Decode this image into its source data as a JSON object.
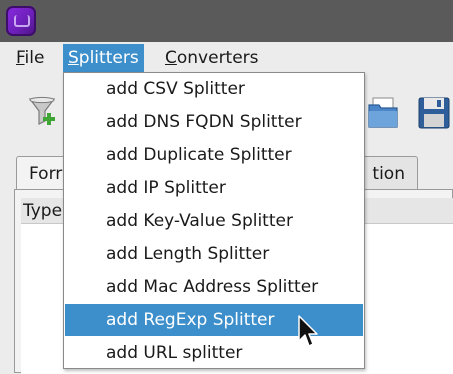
{
  "menubar": {
    "items": [
      {
        "first": "F",
        "rest": "ile"
      },
      {
        "first": "S",
        "rest": "plitters"
      },
      {
        "first": "C",
        "rest": "onverters"
      }
    ]
  },
  "tabs": [
    {
      "label": "Forr"
    },
    {
      "label": "tion"
    }
  ],
  "table": {
    "column_header": "Type"
  },
  "splitters_menu": {
    "items": [
      "add CSV Splitter",
      "add DNS FQDN Splitter",
      "add Duplicate Splitter",
      "add IP Splitter",
      "add Key-Value Splitter",
      "add Length Splitter",
      "add Mac Address Splitter",
      "add RegExp Splitter",
      "add URL splitter"
    ],
    "highlighted_index": 7
  },
  "colors": {
    "highlight": "#3d8fcc",
    "titlebar": "#5a5a5a",
    "app_icon": "#8a2be2"
  },
  "icons": {
    "toolbar_left": "add-filter-icon",
    "toolbar_right_1": "open-folder-icon",
    "toolbar_right_2": "save-floppy-icon"
  }
}
